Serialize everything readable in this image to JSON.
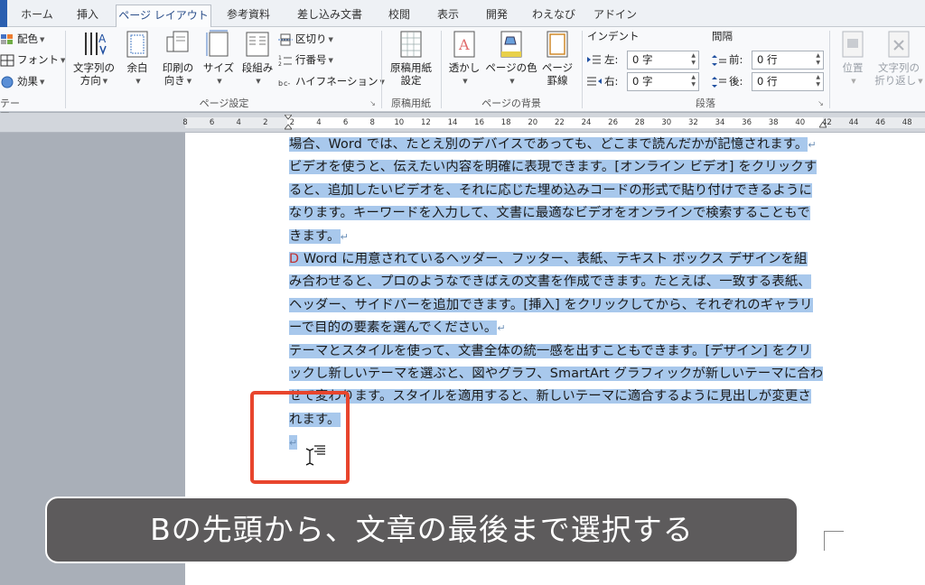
{
  "tabs": [
    {
      "label": "ホーム",
      "active": false
    },
    {
      "label": "挿入",
      "active": false
    },
    {
      "label": "ページ レイアウト",
      "active": true
    },
    {
      "label": "参考資料",
      "active": false
    },
    {
      "label": "差し込み文書",
      "active": false
    },
    {
      "label": "校閲",
      "active": false
    },
    {
      "label": "表示",
      "active": false
    },
    {
      "label": "開発",
      "active": false
    },
    {
      "label": "わえなび",
      "active": false
    },
    {
      "label": "アドイン",
      "active": false
    }
  ],
  "ribbon": {
    "theme": {
      "colors": "配色",
      "fonts": "フォント",
      "effects": "効果",
      "group_label": "テーマ"
    },
    "page_setup": {
      "text_direction_l1": "文字列の",
      "text_direction_l2": "方向",
      "margins": "余白",
      "orientation_l1": "印刷の",
      "orientation_l2": "向き",
      "size": "サイズ",
      "columns": "段組み",
      "breaks": "区切り",
      "line_numbers": "行番号",
      "hyphenation": "ハイフネーション",
      "group_label": "ページ設定"
    },
    "manuscript": {
      "btn_l1": "原稿用紙",
      "btn_l2": "設定",
      "group_label": "原稿用紙"
    },
    "background": {
      "watermark": "透かし",
      "page_color": "ページの色",
      "page_borders_l1": "ページ",
      "page_borders_l2": "罫線",
      "group_label": "ページの背景"
    },
    "paragraph": {
      "indent_title": "インデント",
      "indent_left_label": "左:",
      "indent_left_value": "0 字",
      "indent_right_label": "右:",
      "indent_right_value": "0 字",
      "spacing_title": "間隔",
      "spacing_before_label": "前:",
      "spacing_before_value": "0 行",
      "spacing_after_label": "後:",
      "spacing_after_value": "0 行",
      "group_label": "段落"
    },
    "arrange": {
      "position": "位置",
      "wrap_l1": "文字列の",
      "wrap_l2": "折り返し"
    }
  },
  "ruler": {
    "numbers": [
      "8",
      "6",
      "4",
      "2",
      "2",
      "4",
      "6",
      "8",
      "10",
      "12",
      "14",
      "16",
      "18",
      "20",
      "22",
      "24",
      "26",
      "28",
      "30",
      "32",
      "34",
      "36",
      "38",
      "40",
      "42",
      "44",
      "46",
      "48"
    ]
  },
  "document": {
    "lines": [
      {
        "text": "場合、Word では、たとえ別のデバイスであっても、どこまで読んだかが記憶されます。",
        "mark": "↵",
        "prefix": ""
      },
      {
        "text": "ビデオを使うと、伝えたい内容を明確に表現できます。[オンライン ビデオ] をクリックす",
        "mark": "",
        "prefix": ""
      },
      {
        "text": "ると、追加したいビデオを、それに応じた埋め込みコードの形式で貼り付けできるように",
        "mark": "",
        "prefix": ""
      },
      {
        "text": "なります。キーワードを入力して、文書に最適なビデオをオンラインで検索することもで",
        "mark": "",
        "prefix": ""
      },
      {
        "text": "きます。",
        "mark": "↵",
        "prefix": ""
      },
      {
        "text": " Word に用意されているヘッダー、フッター、表紙、テキスト ボックス デザインを組",
        "mark": "",
        "prefix": "D"
      },
      {
        "text": "み合わせると、プロのようなできばえの文書を作成できます。たとえば、一致する表紙、",
        "mark": "",
        "prefix": ""
      },
      {
        "text": "ヘッダー、サイドバーを追加できます。[挿入] をクリックしてから、それぞれのギャラリ",
        "mark": "",
        "prefix": ""
      },
      {
        "text": "ーで目的の要素を選んでください。",
        "mark": "↵",
        "prefix": ""
      },
      {
        "text": "テーマとスタイルを使って、文書全体の統一感を出すこともできます。[デザイン] をクリ",
        "mark": "",
        "prefix": ""
      },
      {
        "text": "ックし新しいテーマを選ぶと、図やグラフ、SmartArt グラフィックが新しいテーマに合わ",
        "mark": "",
        "prefix": ""
      },
      {
        "text": "せて変わります。スタイルを適用すると、新しいテーマに適合するように見出しが変更さ",
        "mark": "",
        "prefix": ""
      },
      {
        "text": "れます。",
        "mark": "",
        "prefix": ""
      },
      {
        "text": "",
        "mark": "↵",
        "prefix": ""
      }
    ]
  },
  "caption": "Bの先頭から、文章の最後まで選択する",
  "colors": {
    "selection": "#a8c8ec",
    "highlight_box": "#e8452d",
    "caption_bg": "#5d5b5c",
    "active_tab_text": "#2a4e8a"
  }
}
